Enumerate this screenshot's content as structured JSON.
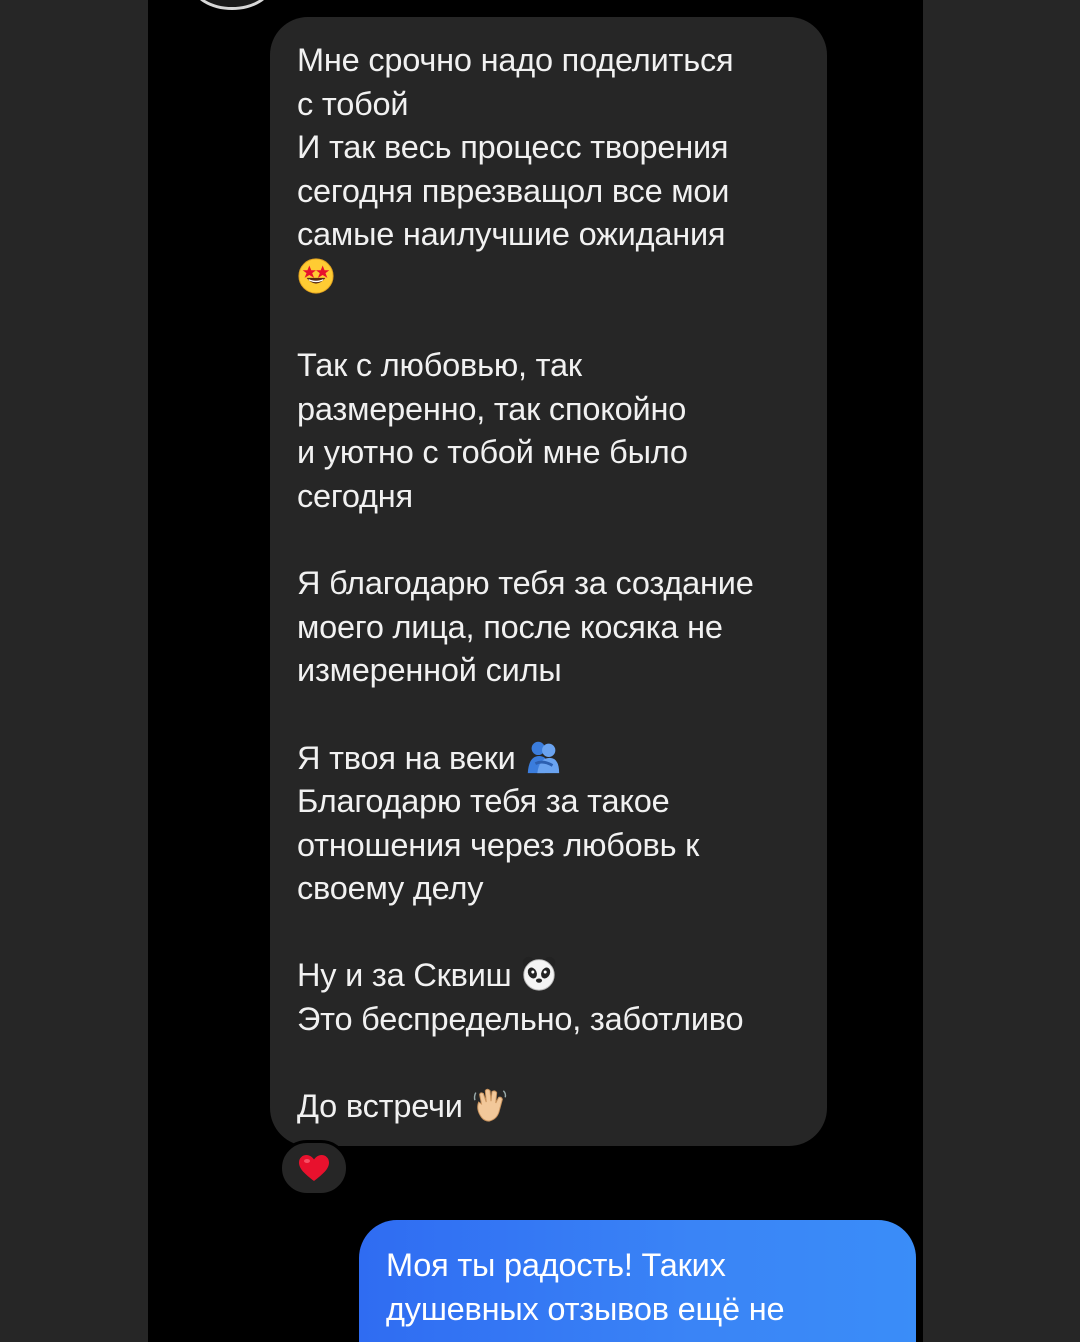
{
  "incoming_message": {
    "paragraphs": [
      "Мне срочно надо поделиться\nс тобой\nИ так весь процесс творения\nсегодня пврезвaщол все мои\nсамые наилучшие ожидания",
      "Так с любовью, так\nразмеренно, так спокойно\nи уютно с тобой мне было\nсегодня",
      "Я благодарю тебя за создание\nмоего лица, после косяка не\nизмеренной силы",
      "Я твоя на веки",
      "Ну и за Сквиш",
      "До встречи"
    ],
    "line_after_hug": "Благодарю тебя за такое\nотношения через любовь к\nсвоему делу",
    "line_after_panda": "Это беспредельно, заботливо",
    "emoji_star_eyes": "star-struck-emoji",
    "emoji_hug": "people-hugging-emoji",
    "emoji_panda": "panda-emoji",
    "emoji_wave": "waving-hand-emoji"
  },
  "reaction": {
    "icon": "red-heart-icon",
    "color": "#e8112d"
  },
  "outgoing_message": {
    "text": "Моя ты радость! Таких\nдушевных отзывов ещё не"
  },
  "colors": {
    "incoming_bubble": "#262626",
    "outgoing_bubble": "#3a84f6",
    "chat_background": "#000000"
  }
}
